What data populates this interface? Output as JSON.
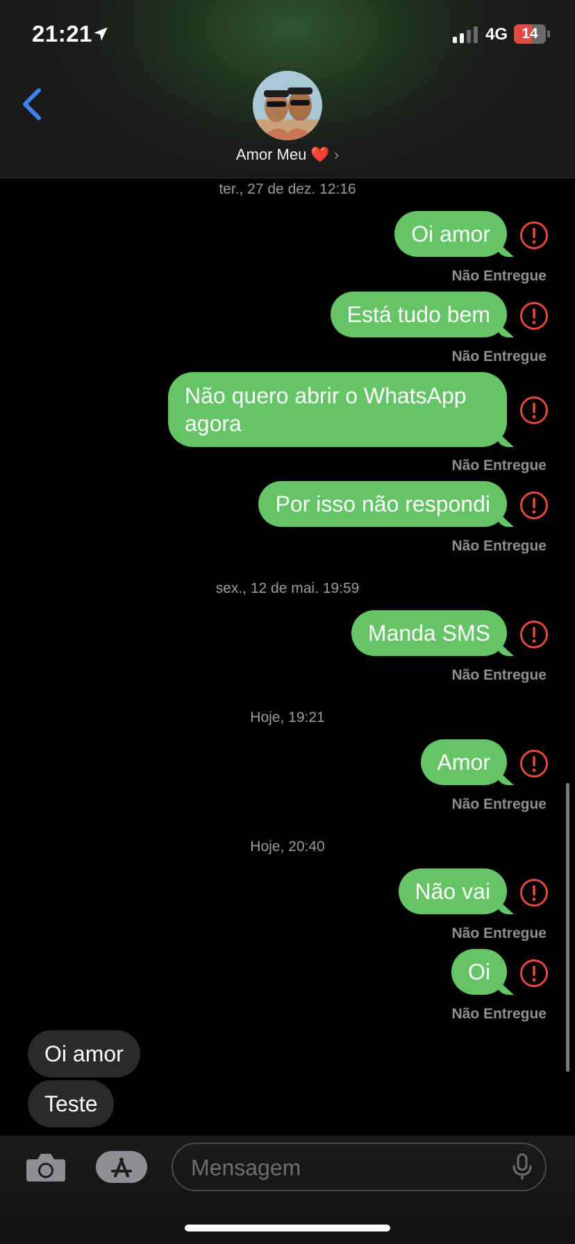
{
  "status_bar": {
    "time": "21:21",
    "network": "4G",
    "battery": "14"
  },
  "header": {
    "contact_name": "Amor Meu ❤️",
    "chevron": "›"
  },
  "conversation": {
    "timestamps": [
      "ter., 27 de dez. 12:16",
      "sex., 12 de mai. 19:59",
      "Hoje, 19:21",
      "Hoje, 20:40"
    ],
    "messages": [
      {
        "text": "Oi amor",
        "status": "Não Entregue"
      },
      {
        "text": "Está tudo bem",
        "status": "Não Entregue"
      },
      {
        "text": "Não quero abrir o WhatsApp agora",
        "status": "Não Entregue"
      },
      {
        "text": "Por isso não respondi",
        "status": "Não Entregue"
      },
      {
        "text": "Manda SMS",
        "status": "Não Entregue"
      },
      {
        "text": "Amor",
        "status": "Não Entregue"
      },
      {
        "text": "Não vai",
        "status": "Não Entregue"
      },
      {
        "text": "Oi",
        "status": "Não Entregue"
      }
    ],
    "error_icon": "exclamation-circle-icon",
    "suggestions": [
      "Oi amor",
      "Teste"
    ]
  },
  "input_bar": {
    "placeholder": "Mensagem"
  },
  "colors": {
    "sms_bubble": "#65c466",
    "error_red": "#e5483f",
    "back_blue": "#3b82f6",
    "timestamp_gray": "#9a9a9f"
  }
}
